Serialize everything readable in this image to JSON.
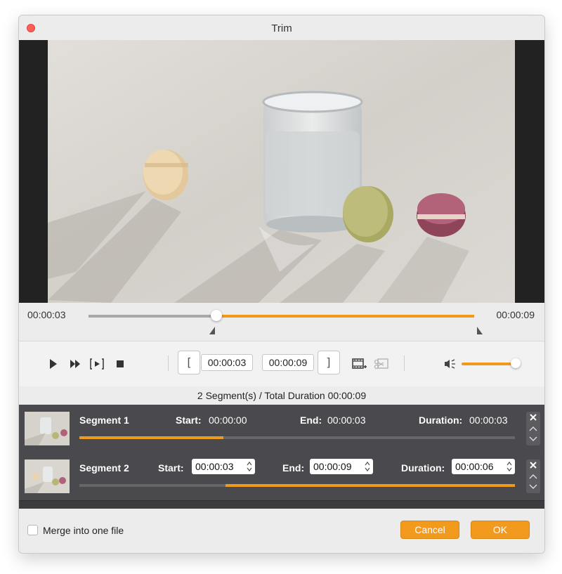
{
  "window": {
    "title": "Trim"
  },
  "timeline": {
    "current_time": "00:00:03",
    "end_time": "00:00:09",
    "progress": 0.33
  },
  "controls": {
    "start_time": "00:00:03",
    "end_time": "00:00:09",
    "start_bracket": "[",
    "end_bracket": "]",
    "volume_level": 0.85
  },
  "summary": {
    "text": "2 Segment(s) / Total Duration 00:00:09"
  },
  "segments": [
    {
      "name": "Segment 1",
      "start_label": "Start:",
      "start": "00:00:00",
      "end_label": "End:",
      "end": "00:00:03",
      "duration_label": "Duration:",
      "duration": "00:00:03",
      "range_start": 0.0,
      "range_end": 0.33
    },
    {
      "name": "Segment 2",
      "start_label": "Start:",
      "start": "00:00:03",
      "end_label": "End:",
      "end": "00:00:09",
      "duration_label": "Duration:",
      "duration": "00:00:06",
      "range_start": 0.335,
      "range_end": 1.0
    }
  ],
  "footer": {
    "merge_label": "Merge into one file",
    "merge_checked": false,
    "cancel_label": "Cancel",
    "ok_label": "OK"
  },
  "colors": {
    "accent": "#f09a1a",
    "track": "#a8a8a8",
    "close": "#ff5f57"
  },
  "icons": [
    "close-window-icon",
    "play-icon",
    "fast-forward-icon",
    "play-selection-icon",
    "stop-icon",
    "add-segment-icon",
    "split-icon",
    "volume-icon",
    "delete-icon",
    "chevron-up-icon",
    "chevron-down-icon"
  ]
}
